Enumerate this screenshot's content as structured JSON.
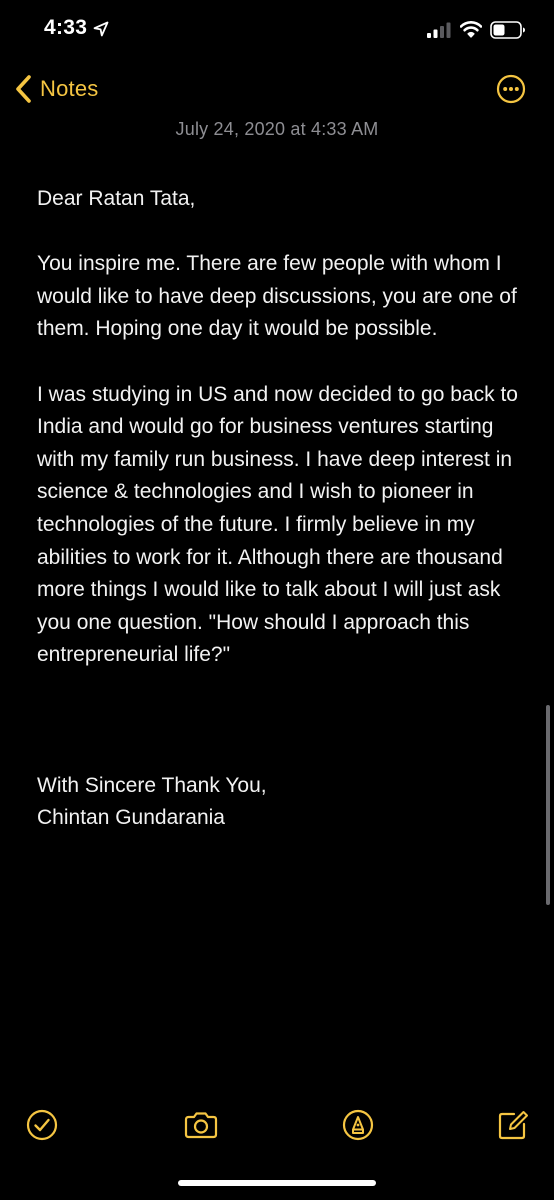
{
  "status_bar": {
    "time": "4:33",
    "icons": [
      "location-arrow-icon",
      "cellular-signal-icon",
      "wifi-icon",
      "battery-icon"
    ]
  },
  "nav": {
    "back_label": "Notes",
    "back_icon": "chevron-left-icon",
    "more_icon": "ellipsis-circle-icon"
  },
  "note": {
    "date": "July 24, 2020 at 4:33 AM",
    "greeting": "Dear Ratan Tata,",
    "paragraph_1": "You inspire me. There are few people with whom I would like to have deep discussions, you are one of them. Hoping one day it would be possible.",
    "paragraph_2": "I was studying in US and now decided to go back to India and would go for business ventures starting with my family run business. I have deep interest in science & technologies and I wish to pioneer in technologies of the future. I firmly believe in my abilities to work for it. Although there are thousand more things I would like to talk about I will just ask you one question. \"How should I approach this entrepreneurial life?\"",
    "closing": "With Sincere Thank You,",
    "signature": "Chintan Gundarania"
  },
  "toolbar": {
    "icons": [
      "checklist-icon",
      "camera-icon",
      "markup-icon",
      "compose-icon"
    ]
  },
  "colors": {
    "background": "#000000",
    "accent": "#f5c542",
    "text": "#f2f2f2",
    "secondary_text": "#8e8e93"
  }
}
